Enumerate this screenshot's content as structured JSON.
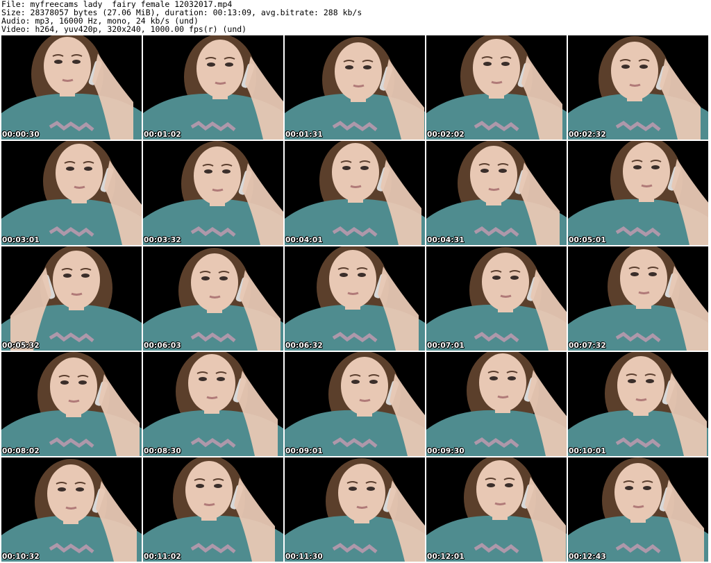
{
  "header": {
    "file": "File: myfreecams_lady__fairy_female_12032017.mp4",
    "size": "Size: 28378057 bytes (27.06 MiB), duration: 00:13:09, avg.bitrate: 288 kb/s",
    "audio": "Audio: mp3, 16000 Hz, mono, 24 kb/s (und)",
    "video": "Video: h264, yuv420p, 320x240, 1000.00 fps(r) (und)"
  },
  "colors": {
    "background": "#000000",
    "shirt": "#4f8c8f",
    "skin": "#e8c8b4",
    "hair": "#6b4a32",
    "phone": "#d8d8d8",
    "print": "#c69bb0"
  },
  "thumbnails": [
    {
      "timestamp": "00:00:30"
    },
    {
      "timestamp": "00:01:02"
    },
    {
      "timestamp": "00:01:31"
    },
    {
      "timestamp": "00:02:02"
    },
    {
      "timestamp": "00:02:32"
    },
    {
      "timestamp": "00:03:01"
    },
    {
      "timestamp": "00:03:32"
    },
    {
      "timestamp": "00:04:01"
    },
    {
      "timestamp": "00:04:31"
    },
    {
      "timestamp": "00:05:01"
    },
    {
      "timestamp": "00:05:32"
    },
    {
      "timestamp": "00:06:03"
    },
    {
      "timestamp": "00:06:32"
    },
    {
      "timestamp": "00:07:01"
    },
    {
      "timestamp": "00:07:32"
    },
    {
      "timestamp": "00:08:02"
    },
    {
      "timestamp": "00:08:30"
    },
    {
      "timestamp": "00:09:01"
    },
    {
      "timestamp": "00:09:30"
    },
    {
      "timestamp": "00:10:01"
    },
    {
      "timestamp": "00:10:32"
    },
    {
      "timestamp": "00:11:02"
    },
    {
      "timestamp": "00:11:30"
    },
    {
      "timestamp": "00:12:01"
    },
    {
      "timestamp": "00:12:43"
    }
  ]
}
